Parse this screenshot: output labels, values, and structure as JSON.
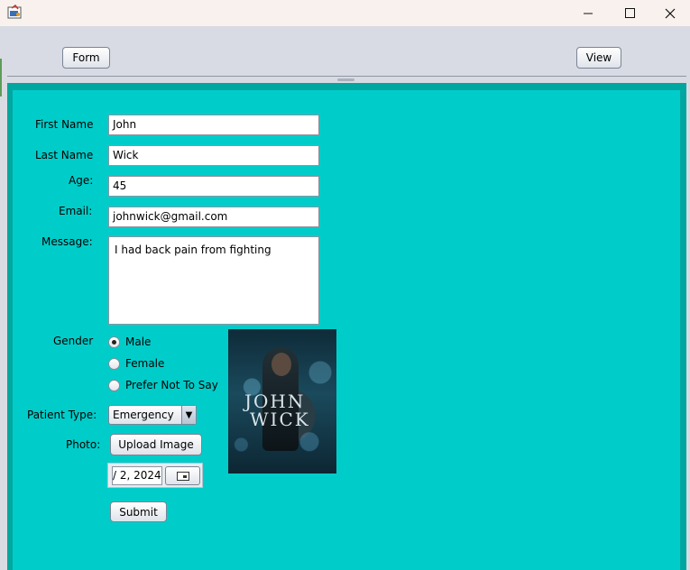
{
  "window": {
    "minimize_glyph": "—",
    "maximize_glyph": "☐",
    "close_glyph": "✕"
  },
  "toolbar": {
    "form_label": "Form",
    "view_label": "View"
  },
  "form": {
    "first_name_label": "First Name",
    "first_name_value": "John",
    "last_name_label": "Last Name",
    "last_name_value": "Wick",
    "age_label": "Age:",
    "age_value": "45",
    "email_label": "Email:",
    "email_value": "johnwick@gmail.com",
    "message_label": "Message:",
    "message_value": "I had back pain from fighting",
    "gender_label": "Gender",
    "gender_options": [
      "Male",
      "Female",
      "Prefer Not To Say"
    ],
    "gender_selected": "Male",
    "patient_type_label": "Patient Type:",
    "patient_type_value": "Emergency",
    "photo_label": "Photo:",
    "upload_label": "Upload Image",
    "date_value": "/ 2, 2024",
    "submit_label": "Submit"
  },
  "poster": {
    "title_line1": "JOHN",
    "title_line2": "WICK"
  },
  "colors": {
    "panel_border": "#00a6a0",
    "panel_fill": "#00cdca",
    "toolbar_bg": "#d8dbe3",
    "titlebar_bg": "#f9f1ed"
  }
}
